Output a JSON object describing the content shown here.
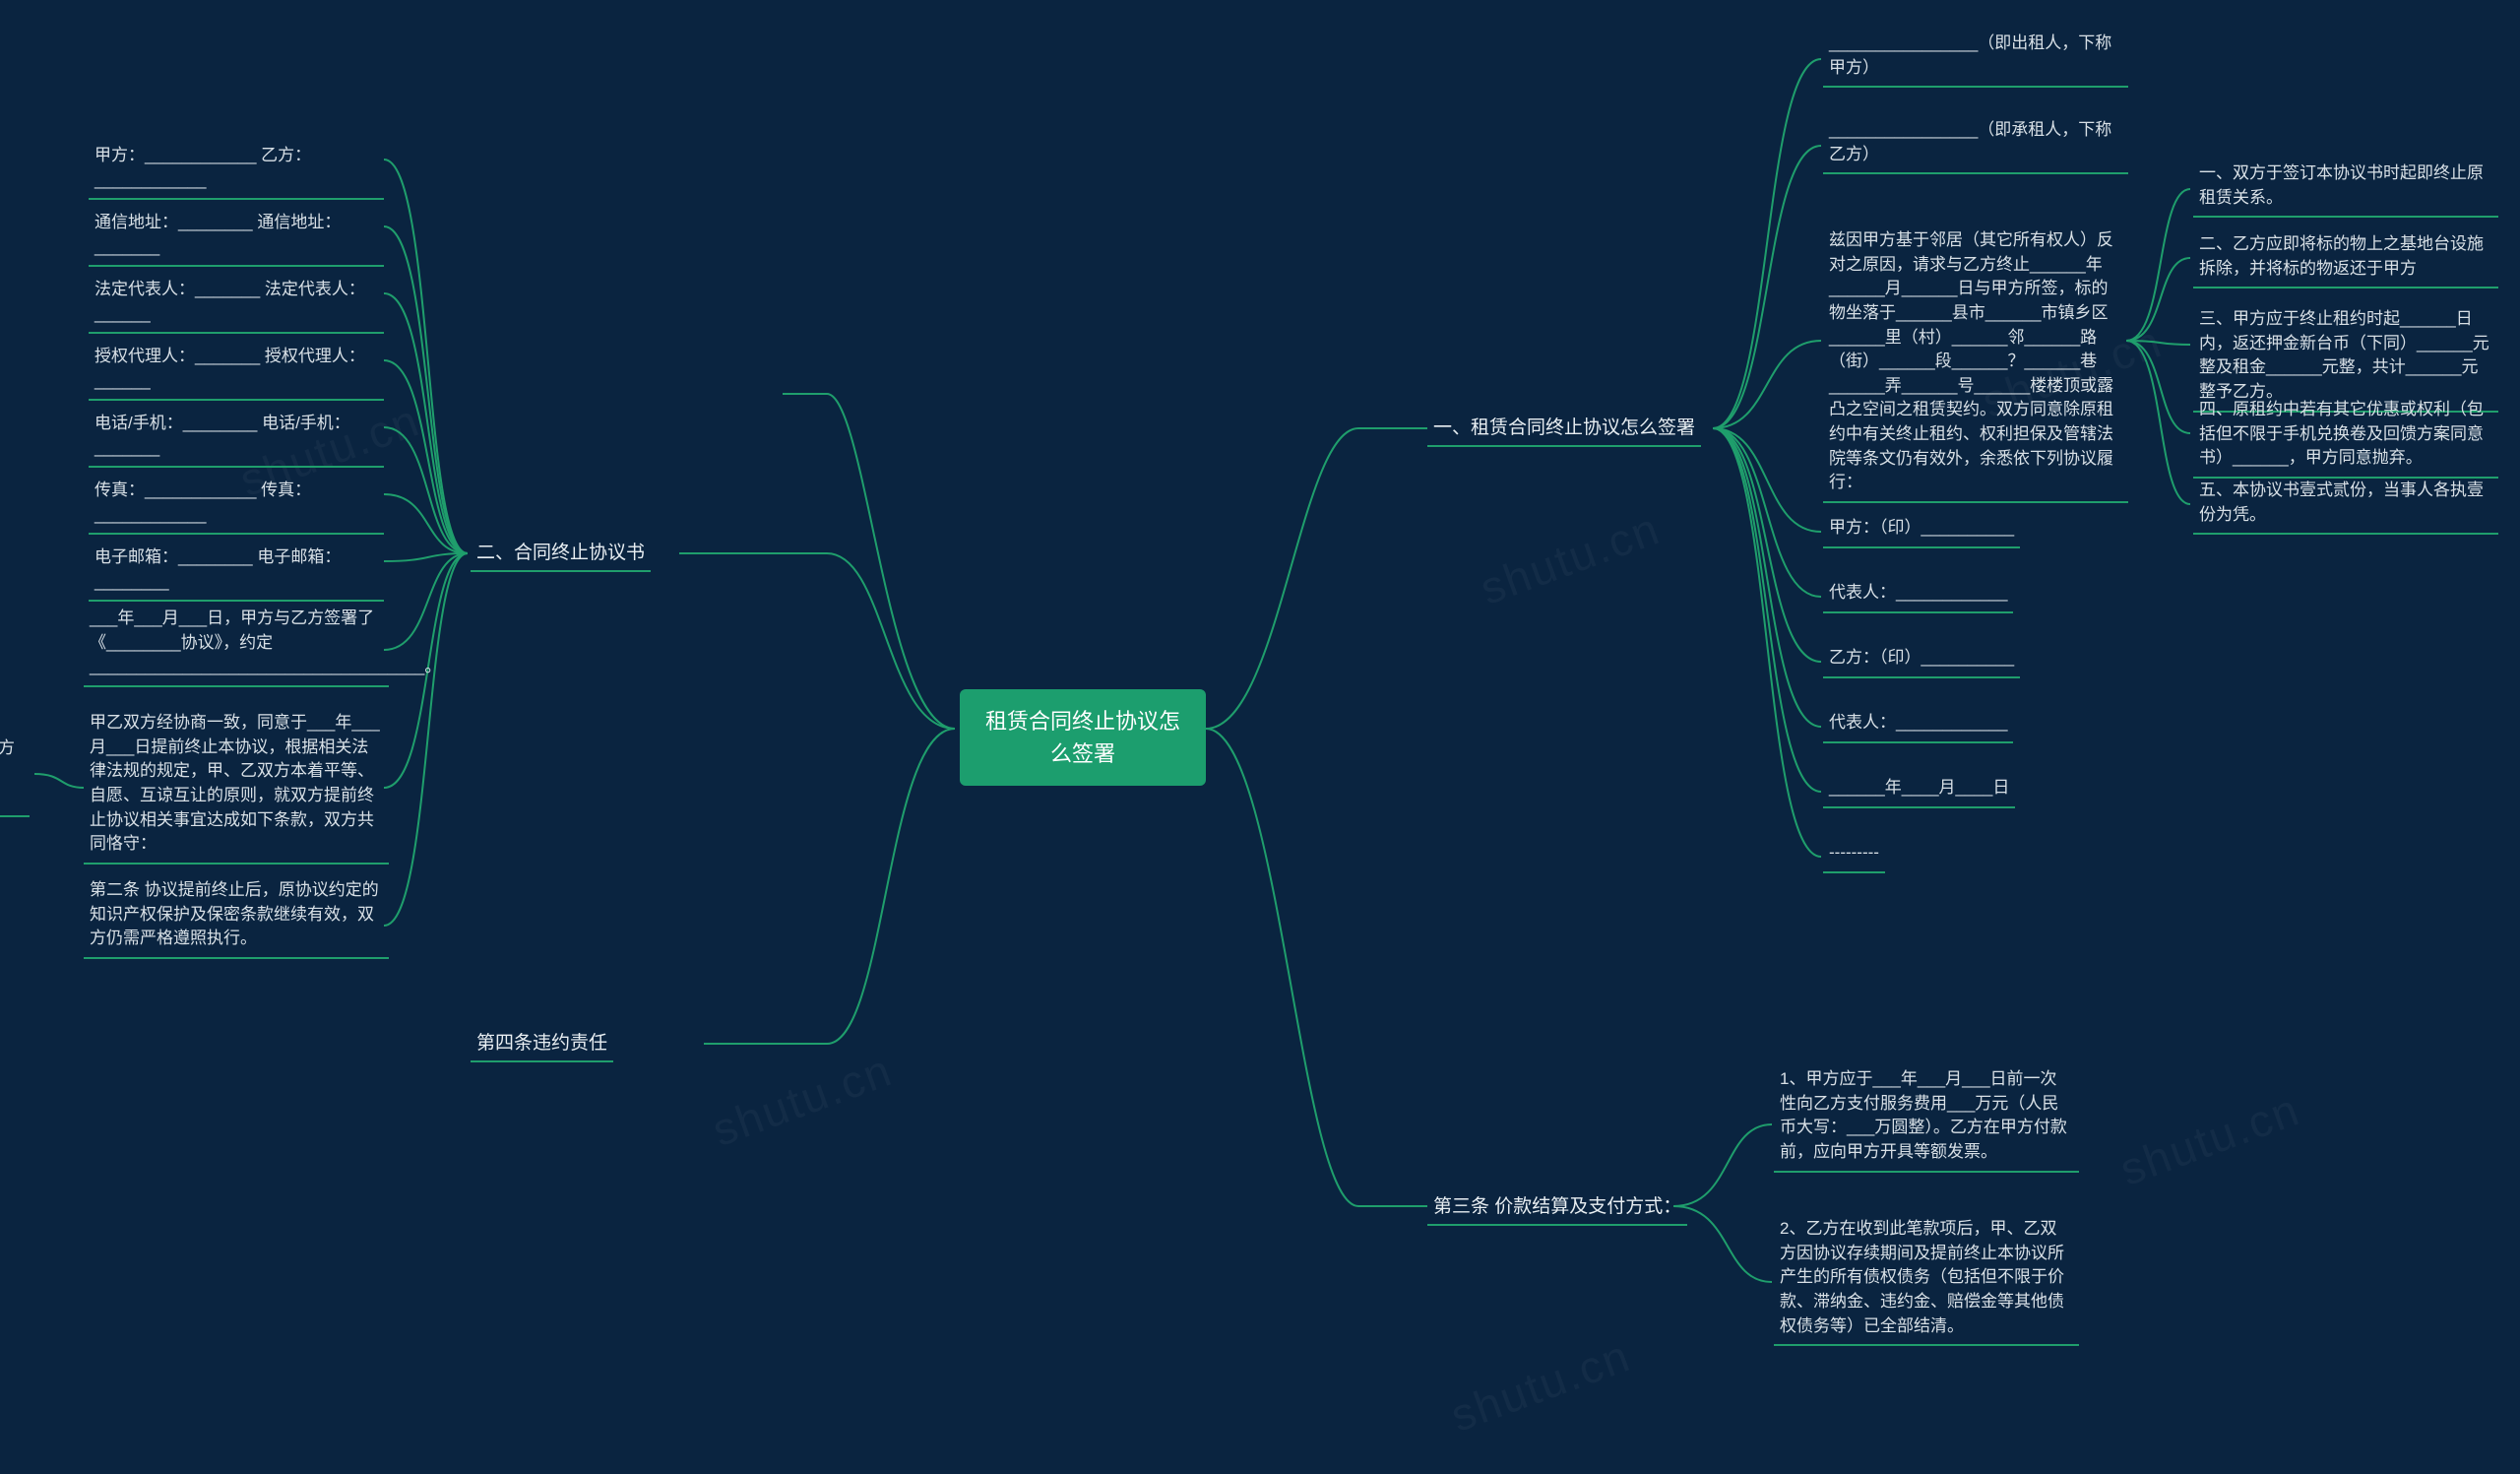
{
  "root": "租赁合同终止协议怎么签署",
  "watermark": "shutu.cn",
  "section1": {
    "title": "一、租赁合同终止协议怎么签署",
    "party_a": "________________（即出租人，下称甲方）",
    "party_b": "________________（即承租人，下称乙方）",
    "preface": "兹因甲方基于邻居（其它所有权人）反对之原因，请求与乙方终止______年______月______日与甲方所签，标的物坐落于______县市______市镇乡区______里（村）______邻______路（街）______段______？______巷______弄______号______楼楼顶或露凸之空间之租赁契约。双方同意除原租约中有关终止租约、权利担保及管辖法院等条文仍有效外，余悉依下列协议履行：",
    "items": {
      "i1": "一、双方于签订本协议书时起即终止原租赁关系。",
      "i2": "二、乙方应即将标的物上之基地台设施拆除，并将标的物返还于甲方",
      "i3": "三、甲方应于终止租约时起______日内，返还押金新台币（下同）______元整及租金______元整，共计______元整予乙方。",
      "i4": "四、原租约中若有其它优惠或权利（包括但不限于手机兑换卷及回馈方案同意书）______，甲方同意抛弃。",
      "i5": "五、本协议书壹式贰份，当事人各执壹份为凭。"
    },
    "sign_a": "甲方：（印）__________",
    "rep_a": "代表人：____________",
    "sign_b": "乙方：（印）__________",
    "rep_b": "代表人：____________",
    "date": "______年____月____日",
    "dashes": "---------"
  },
  "section2": {
    "title": "二、合同终止协议书",
    "fields": {
      "f1": "甲方：____________ 乙方：____________",
      "f2": "通信地址：________ 通信地址：_______",
      "f3": "法定代表人：_______ 法定代表人：______",
      "f4": "授权代理人：_______ 授权代理人：______",
      "f5": "电话/手机：________ 电话/手机：_______",
      "f6": "传真：____________ 传真：____________",
      "f7": "电子邮箱：________ 电子邮箱：________"
    },
    "signed": "___年___月___日，甲方与乙方签署了《________协议》，约定____________________________________。",
    "clause_main": "甲乙双方经协商一致，同意于___年___月___日提前终止本协议，根据相关法律法规的规定，甲、乙双方本着平等、自愿、互谅互让的原则，就双方提前终止协议相关事宜达成如下条款，双方共同恪守：",
    "clause1": "第一条甲、乙双方同意，提前终止双方于___年___月___日签订的《____________协议》。",
    "clause2": "第二条 协议提前终止后，原协议约定的知识产权保护及保密条款继续有效，双方仍需严格遵照执行。"
  },
  "section3": {
    "title": "第三条 价款结算及支付方式：",
    "p1": "1、甲方应于___年___月___日前一次性向乙方支付服务费用___万元（人民币大写：___万圆整）。乙方在甲方付款前，应向甲方开具等额发票。",
    "p2": "2、乙方在收到此笔款项后，甲、乙双方因协议存续期间及提前终止本协议所产生的所有债权债务（包括但不限于价款、滞纳金、违约金、赔偿金等其他债权债务等）已全部结清。"
  },
  "section4": {
    "title": "第四条违约责任"
  }
}
